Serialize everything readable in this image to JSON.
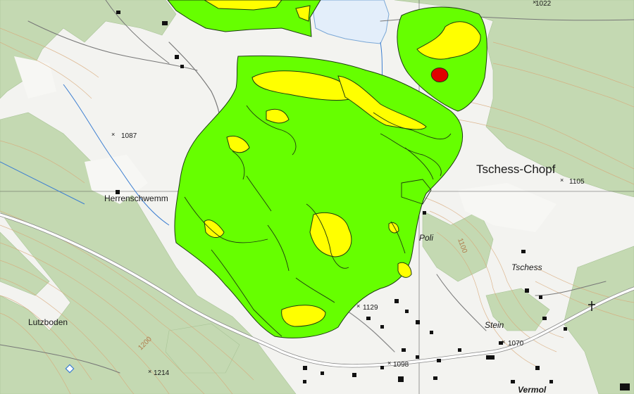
{
  "map": {
    "title": "",
    "places": {
      "tschess_chopf": "Tschess-Chopf",
      "herrenschwemm": "Herrenschwemm",
      "lutzboden": "Lutzboden",
      "poli": "Poli",
      "tschess": "Tschess",
      "stein": "Stein",
      "vermol": "Vermol"
    },
    "elevations": {
      "e1022": "1022",
      "e1087": "1087",
      "e1105": "1105",
      "e1129": "1129",
      "e1070": "1070",
      "e1098": "1098",
      "e1214": "1214"
    },
    "contour_labels": {
      "c1100": "1100",
      "c1200": "1200"
    },
    "colors": {
      "background": "#f3f3f0",
      "forest": "#c4d9b2",
      "lake": "#e3eefa",
      "green_zone": "#66ff00",
      "yellow_zone": "#ffff00",
      "red_zone": "#e00000",
      "contour": "#d8a878",
      "road": "#ffffff",
      "building": "#111111"
    },
    "icons": {
      "elevation_point": "cross-mark",
      "church": "cross-icon",
      "info_point": "diamond-icon"
    }
  }
}
